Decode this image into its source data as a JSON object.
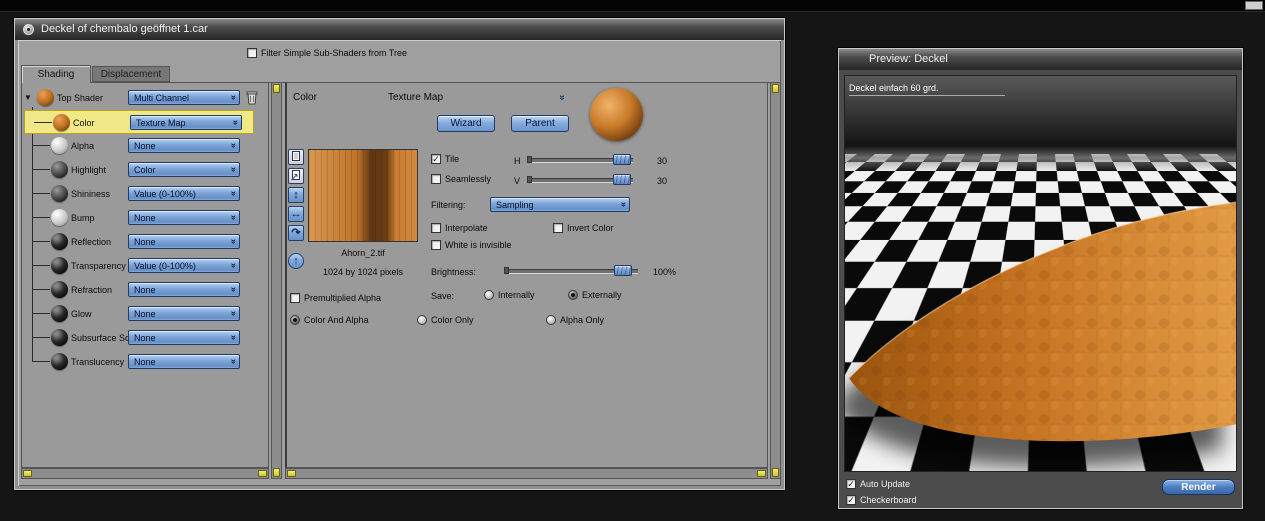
{
  "shader_window": {
    "title": "Deckel of chembalo geöffnet 1.car",
    "filter_label": "Filter Simple Sub-Shaders from Tree",
    "tabs": {
      "shading": "Shading",
      "displacement": "Displacement"
    },
    "tree": {
      "items": [
        {
          "label": "Top Shader",
          "value": "Multi Channel"
        },
        {
          "label": "Color",
          "value": "Texture Map"
        },
        {
          "label": "Alpha",
          "value": "None"
        },
        {
          "label": "Highlight",
          "value": "Color"
        },
        {
          "label": "Shininess",
          "value": "Value (0-100%)"
        },
        {
          "label": "Bump",
          "value": "None"
        },
        {
          "label": "Reflection",
          "value": "None"
        },
        {
          "label": "Transparency",
          "value": "Value (0-100%)"
        },
        {
          "label": "Refraction",
          "value": "None"
        },
        {
          "label": "Glow",
          "value": "None"
        },
        {
          "label": "Subsurface Sc",
          "value": "None"
        },
        {
          "label": "Translucency",
          "value": "None"
        }
      ]
    },
    "editor": {
      "channel": "Color",
      "shader_type": "Texture Map",
      "wizard": "Wizard",
      "parent": "Parent",
      "texture_name": "Ahorn_2.tif",
      "texture_size": "1024 by 1024 pixels",
      "premultiplied": "Premultiplied Alpha",
      "color_and_alpha": "Color And Alpha",
      "color_only": "Color Only",
      "alpha_only": "Alpha Only",
      "tile": "Tile",
      "seamlessly": "Seamlessly",
      "h": "H",
      "v": "V",
      "h_value": "30",
      "v_value": "30",
      "filtering": "Filtering:",
      "filtering_value": "Sampling",
      "interpolate": "Interpolate",
      "invert_color": "Invert Color",
      "white_invisible": "White is invisible",
      "brightness": "Brightness:",
      "brightness_value": "100%",
      "save": "Save:",
      "internally": "Internally",
      "externally": "Externally"
    }
  },
  "preview_window": {
    "title": "Preview: Deckel",
    "overlay": "Deckel einfach 60 grd.",
    "auto_update": "Auto Update",
    "checkerboard": "Checkerboard",
    "render": "Render"
  },
  "icons": {
    "double_chevron": "»",
    "flip_vertical": "↕",
    "flip_horizontal": "↔",
    "rotate": "↷",
    "move_up": "↑",
    "check": "✓",
    "disclosure_open": "▼"
  },
  "colors": {
    "accent_blue": "#6f9ed8",
    "selection_yellow": "#f1e987",
    "scrollbar_yellow": "#cfc431",
    "lid_orange": "#c87628"
  }
}
